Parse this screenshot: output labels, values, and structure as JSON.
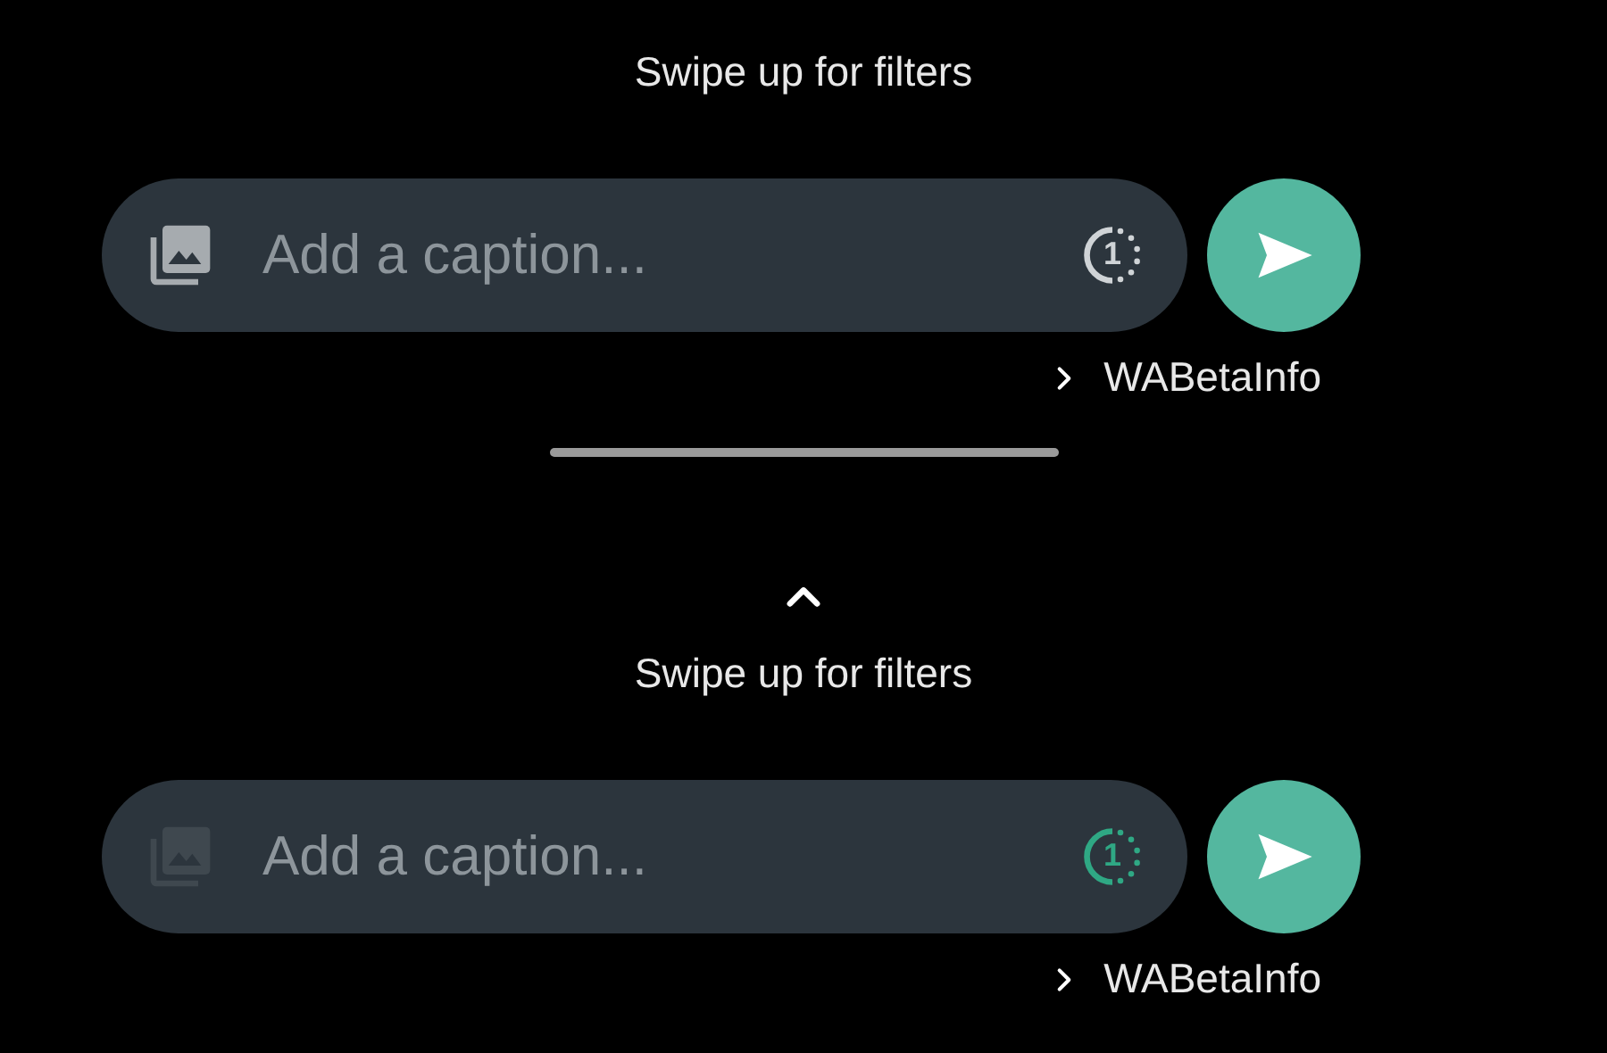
{
  "panels": [
    {
      "caret": false,
      "hint": "Swipe up for filters",
      "caption": {
        "placeholder": "Add a caption...",
        "gallery_disabled": false,
        "view_once": {
          "label": "1",
          "on": false
        }
      },
      "recipient": "WABetaInfo"
    },
    {
      "caret": true,
      "hint": "Swipe up for filters",
      "caption": {
        "placeholder": "Add a caption...",
        "gallery_disabled": true,
        "view_once": {
          "label": "1",
          "on": true
        }
      },
      "recipient": "WABetaInfo"
    }
  ]
}
